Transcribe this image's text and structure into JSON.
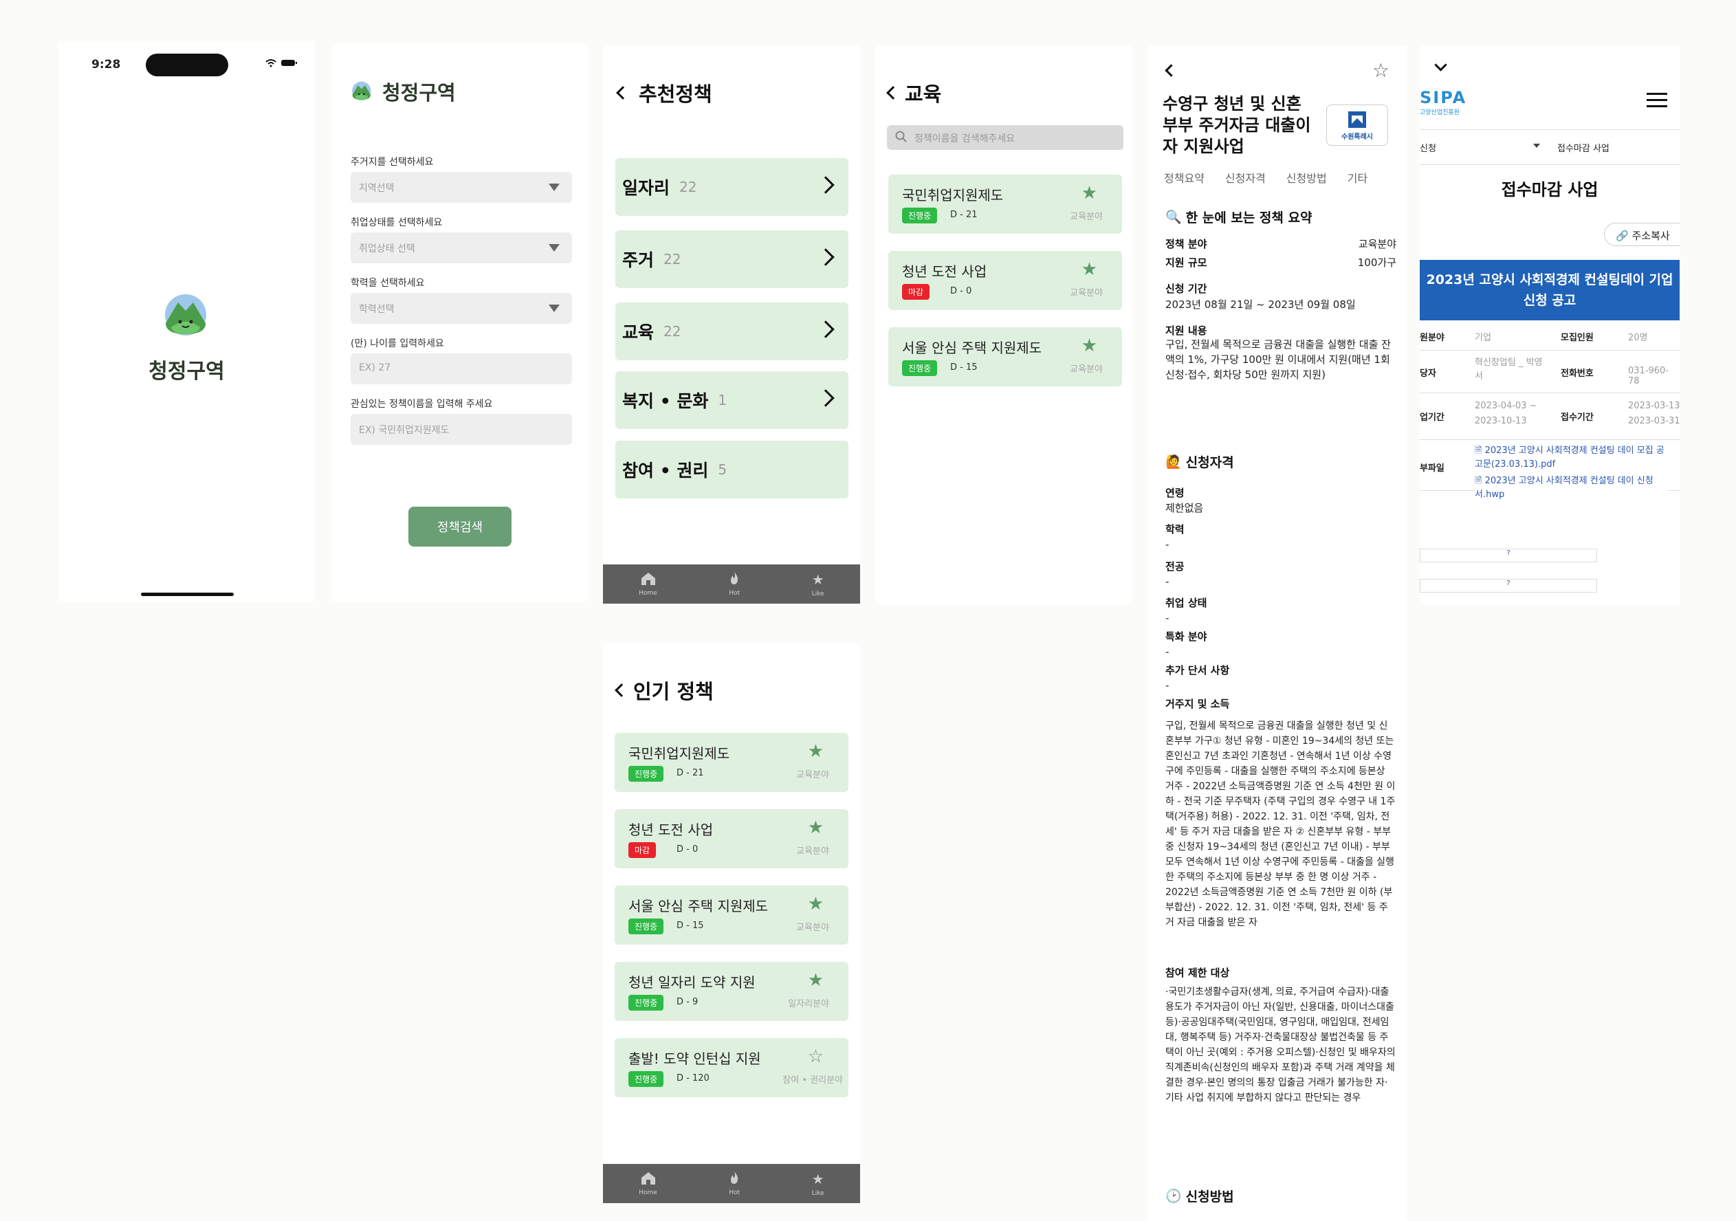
{
  "splash": {
    "time": "9:28",
    "app_name": "청정구역"
  },
  "filter": {
    "app_name": "청정구역",
    "fields": [
      {
        "label": "주거지를 선택하세요",
        "placeholder": "지역선택"
      },
      {
        "label": "취업상태를 선택하세요",
        "placeholder": "취업상태 선택"
      },
      {
        "label": "학력을 선택하세요",
        "placeholder": "학력선택"
      },
      {
        "label": "(만) 나이를 입력하세요",
        "placeholder": "EX) 27"
      },
      {
        "label": "관심있는 정책이름을 입력해 주세요",
        "placeholder": "EX) 국민취업지원제도"
      }
    ],
    "button": "정책검색"
  },
  "recommend": {
    "title": "추천정책",
    "categories": [
      {
        "name": "일자리",
        "count": "22"
      },
      {
        "name": "주거",
        "count": "22"
      },
      {
        "name": "교육",
        "count": "22"
      },
      {
        "name": "복지 • 문화",
        "count": "1"
      },
      {
        "name": "참여 • 권리",
        "count": "5"
      }
    ]
  },
  "tabs": {
    "home": "Home",
    "hot": "Hot",
    "like": "Like"
  },
  "education": {
    "title": "교육",
    "search_placeholder": "정책이름을 검색해주세요",
    "policies": [
      {
        "name": "국민취업지원제도",
        "status": "진행중",
        "dday": "D - 21",
        "field": "교육분야"
      },
      {
        "name": "청년 도전 사업",
        "status": "마감",
        "dday": "D - 0",
        "field": "교육분야"
      },
      {
        "name": "서울 안심 주택 지원제도",
        "status": "진행중",
        "dday": "D - 15",
        "field": "교육분야"
      }
    ]
  },
  "popular": {
    "title": "인기 정책",
    "policies": [
      {
        "name": "국민취업지원제도",
        "status": "진행중",
        "dday": "D - 21",
        "field": "교육분야",
        "starred": true
      },
      {
        "name": "청년 도전 사업",
        "status": "마감",
        "dday": "D - 0",
        "field": "교육분야",
        "starred": true
      },
      {
        "name": "서울 안심 주택 지원제도",
        "status": "진행중",
        "dday": "D - 15",
        "field": "교육분야",
        "starred": true
      },
      {
        "name": "청년 일자리 도약 지원",
        "status": "진행중",
        "dday": "D - 9",
        "field": "일자리분야",
        "starred": true
      },
      {
        "name": "출발! 도약 인턴십 지원",
        "status": "진행중",
        "dday": "D - 120",
        "field": "참여 • 권리분야",
        "starred": false
      }
    ]
  },
  "detail": {
    "title": "수영구 청년 및 신혼부부 주거자금 대출이자 지원사업",
    "seal_text": "수원특례시",
    "tabs": [
      "정책요약",
      "신청자격",
      "신청방법",
      "기타"
    ],
    "summary_title": "한 눈에 보는 정책 요약",
    "field_label": "정책 분야",
    "field_value": "교육분야",
    "scale_label": "지원 규모",
    "scale_value": "100가구",
    "period_label": "신청 기간",
    "period_value": "2023년 08월 21일 ~ 2023년 09월 08일",
    "content_label": "지원 내용",
    "content_value": "구입, 전월세 목적으로 금융권 대출을 실행한 대출 잔액의 1%, 가구당 100만 원 이내에서 지원(매년 1회 신청·접수, 회차당 50만 원까지 지원)",
    "qual_title": "신청자격",
    "quals": [
      {
        "k": "연령",
        "v": "제한없음"
      },
      {
        "k": "학력",
        "v": "-"
      },
      {
        "k": "전공",
        "v": "-"
      },
      {
        "k": "취업 상태",
        "v": "-"
      },
      {
        "k": "특화 분야",
        "v": "-"
      },
      {
        "k": "추가 단서 사항",
        "v": "-"
      }
    ],
    "residence_label": "거주지 및 소득",
    "residence_value": "구입, 전월세 목적으로 금융권 대출을 실행한 청년 및 신혼부부 가구① 청년 유형 - 미혼인 19~34세의 청년 또는 혼인신고 7년 초과인 기혼청년 - 연속해서 1년 이상 수영구에 주민등록 - 대출을 실행한 주택의 주소지에 등본상 거주 - 2022년 소득금액증명원 기준 연 소득 4천만 원 이하 - 전국 기준 무주택자 (주택 구입의 경우 수영구 내 1주택(거주용) 허용) - 2022. 12. 31. 이전 '주택, 임차, 전세' 등 주거 자금 대출을 받은 자 ② 신혼부부 유형 - 부부 중 신청자 19~34세의 청년 (혼인신고 7년 이내) - 부부 모두 연속해서 1년 이상 수영구에 주민등록 - 대출을 실행한 주택의 주소지에 등본상 부부 중 한 명 이상 거주 - 2022년 소득금액증명원 기준 연 소득 7천만 원 이하 (부부합산) - 2022. 12. 31. 이전 '주택, 임차, 전세' 등 주거 자금 대출을 받은 자",
    "limit_label": "참여 제한 대상",
    "limit_value": "·국민기초생활수급자(생계, 의료, 주거급여 수급자)·대출 용도가 주거자금이 아닌 자(일반, 신용대출, 마이너스대출 등)·공공임대주택(국민임대, 영구임대, 매입임대, 전세임대, 행복주택 등) 거주자·건축물대장상 불법건축물 등 주택이 아닌 곳(예외 : 주거용 오피스텔)·신청인 및 배우자의 직계존비속(신청인의 배우자 포함)과 주택 거래 계약을 체결한 경우·본인 명의의 통장 입출금 거래가 불가능한 자·기타 사업 취지에 부합하지 않다고 판단되는 경우",
    "method_title": "신청방법"
  },
  "web": {
    "logo": "SIPA",
    "logo_sub": "고양산업진흥원",
    "filter_left": "신청",
    "filter_right": "접수마감 사업",
    "title": "접수마감 사업",
    "share": "주소복사",
    "headline": "2023년 고양시 사회적경제 컨설팅데이 기업 신청 공고",
    "rows": [
      {
        "k1": "원분야",
        "v1": "기업",
        "k2": "모집인원",
        "v2": "20명"
      },
      {
        "k1": "당자",
        "v1": "혁신창업팀 _ 박영서",
        "k2": "전화번호",
        "v2": "031-960-78"
      },
      {
        "k1": "업기간",
        "v1": "2023-04-03 ~ 2023-10-13",
        "k2": "접수기간",
        "v2": "2023-03-13 2023-03-31"
      }
    ],
    "files_label": "부파일",
    "files": [
      "2023년 고양시 사회적경제 컨설팅 데이 모집 공고문(23.03.13).pdf",
      "2023년 고양시 사회적경제 컨설팅 데이 신청서.hwp"
    ],
    "qmark": "?"
  },
  "colors": {
    "accent": "#6a9e75",
    "card": "#dff0df",
    "ongoing": "#2dbb46",
    "closed": "#e8232b",
    "tabbar": "#5e5e5e",
    "web_blue": "#1f62b8"
  }
}
